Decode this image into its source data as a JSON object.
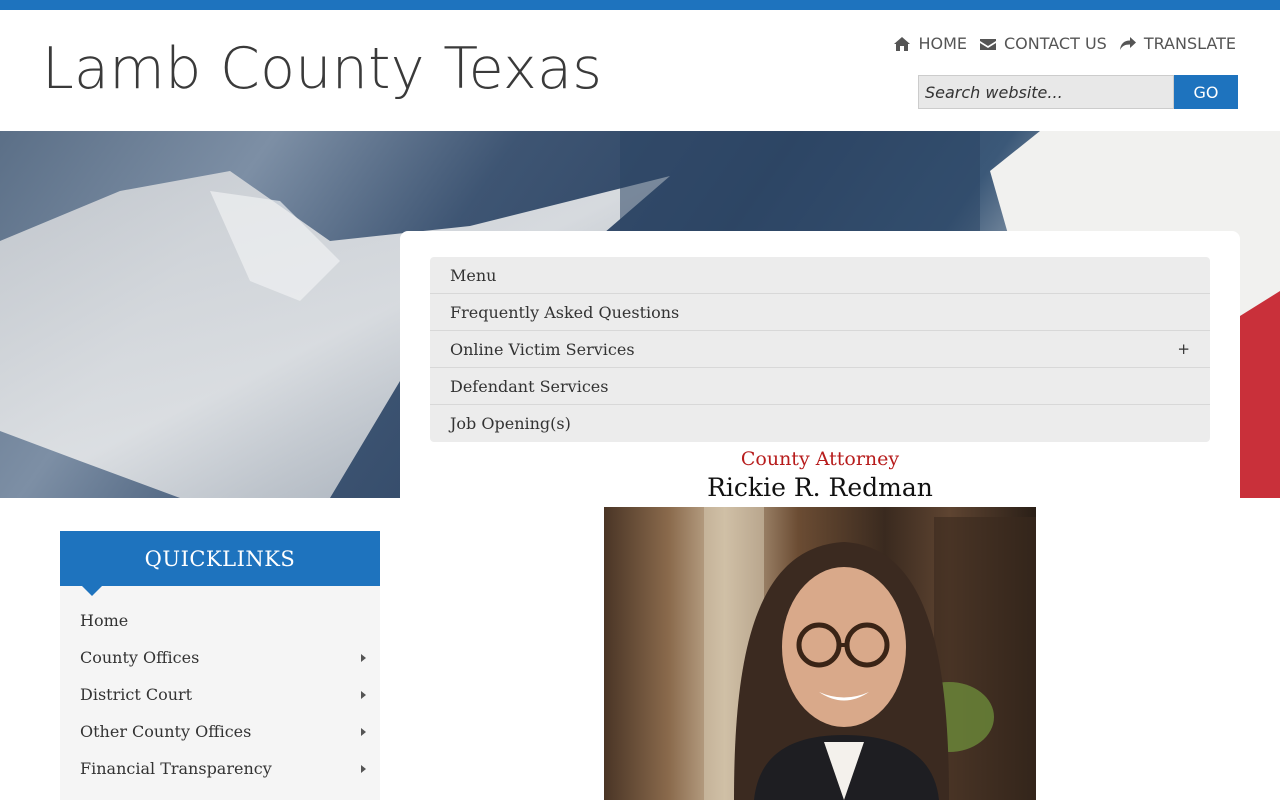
{
  "header": {
    "site_title": "Lamb County Texas",
    "nav": [
      {
        "label": "HOME",
        "icon": "home-icon"
      },
      {
        "label": "CONTACT US",
        "icon": "envelope-icon"
      },
      {
        "label": "TRANSLATE",
        "icon": "share-arrow-icon"
      }
    ],
    "search": {
      "placeholder": "Search website...",
      "button_label": "GO"
    }
  },
  "colors": {
    "brand_blue": "#1e73be",
    "accent_red": "#b71c1c"
  },
  "sub_menu": [
    {
      "label": "Menu",
      "expandable": false
    },
    {
      "label": "Frequently Asked Questions",
      "expandable": false
    },
    {
      "label": "Online Victim Services",
      "expandable": true,
      "toggle": "+"
    },
    {
      "label": "Defendant Services",
      "expandable": false
    },
    {
      "label": "Job Opening(s)",
      "expandable": false
    }
  ],
  "profile": {
    "role": "County Attorney",
    "name": "Rickie R. Redman"
  },
  "quicklinks": {
    "title": "QUICKLINKS",
    "items": [
      {
        "label": "Home",
        "has_submenu": false
      },
      {
        "label": "County Offices",
        "has_submenu": true
      },
      {
        "label": "District Court",
        "has_submenu": true
      },
      {
        "label": "Other County Offices",
        "has_submenu": true
      },
      {
        "label": "Financial Transparency",
        "has_submenu": true
      }
    ]
  }
}
